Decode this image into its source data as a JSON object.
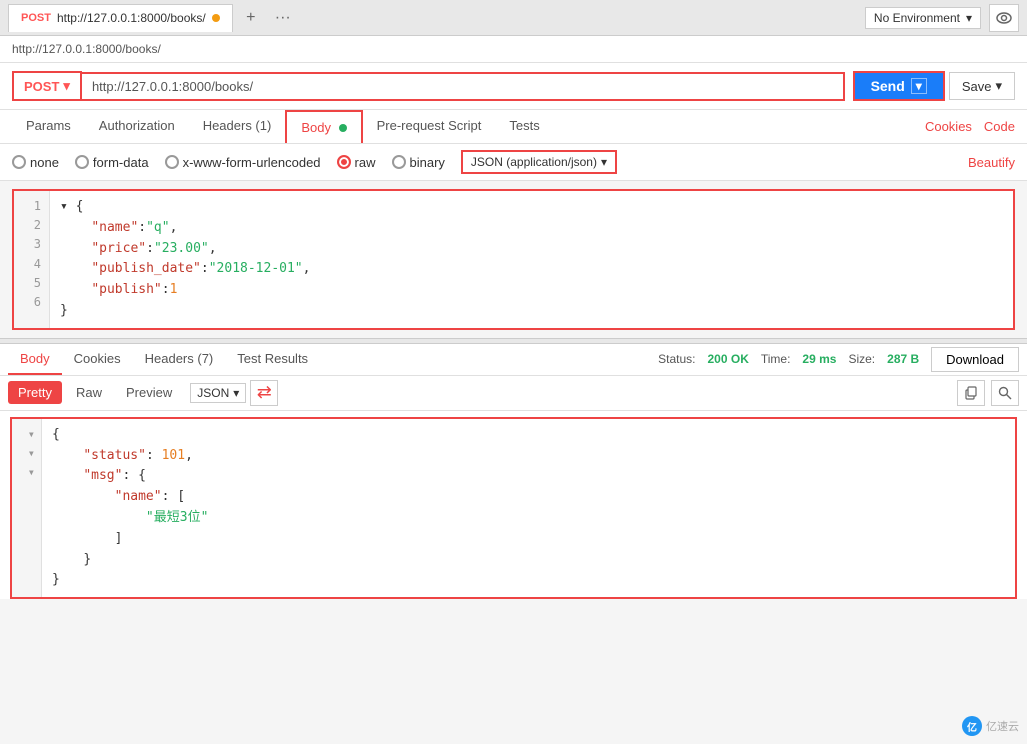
{
  "tab": {
    "method_label": "POST",
    "url_short": "http://127.0.0.1:8000/books/",
    "dot_color": "#f39c12"
  },
  "env_selector": {
    "label": "No Environment",
    "chevron": "▾"
  },
  "breadcrumb": {
    "url": "http://127.0.0.1:8000/books/"
  },
  "request": {
    "method": "POST",
    "url": "http://127.0.0.1:8000/books/",
    "send_label": "Send",
    "save_label": "Save"
  },
  "req_tabs": {
    "params": "Params",
    "authorization": "Authorization",
    "headers": "Headers (1)",
    "body": "Body",
    "pre_request": "Pre-request Script",
    "tests": "Tests"
  },
  "right_links": {
    "cookies": "Cookies",
    "code": "Code"
  },
  "body_options": {
    "none": "none",
    "form_data": "form-data",
    "urlencoded": "x-www-form-urlencoded",
    "raw": "raw",
    "binary": "binary",
    "json_format": "JSON (application/json)",
    "beautify": "Beautify"
  },
  "request_body": {
    "lines": [
      "1 ▾ {",
      "2     \"name\":\"q\",",
      "3     \"price\":\"23.00\",",
      "4     \"publish_date\":\"2018-12-01\",",
      "5     \"publish\":1",
      "6 }"
    ],
    "line_numbers": [
      "1",
      "2",
      "3",
      "4",
      "5",
      "6"
    ]
  },
  "response": {
    "tabs": {
      "body": "Body",
      "cookies": "Cookies",
      "headers7": "Headers (7)",
      "test_results": "Test Results"
    },
    "status": "200 OK",
    "time": "29 ms",
    "size": "287 B",
    "download": "Download",
    "format_tabs": {
      "pretty": "Pretty",
      "raw": "Raw",
      "preview": "Preview"
    },
    "json_label": "JSON",
    "code_lines": [
      "  {",
      "      \"status\": 101,",
      "      \"msg\": {",
      "          \"name\": [",
      "              \"最短3位\"",
      "          ]",
      "      }",
      "  }"
    ],
    "line_numbers": [
      "▾",
      "·",
      "▾",
      "▾",
      "·",
      "·",
      "·",
      "·"
    ]
  },
  "watermark": {
    "text": "亿速云"
  }
}
